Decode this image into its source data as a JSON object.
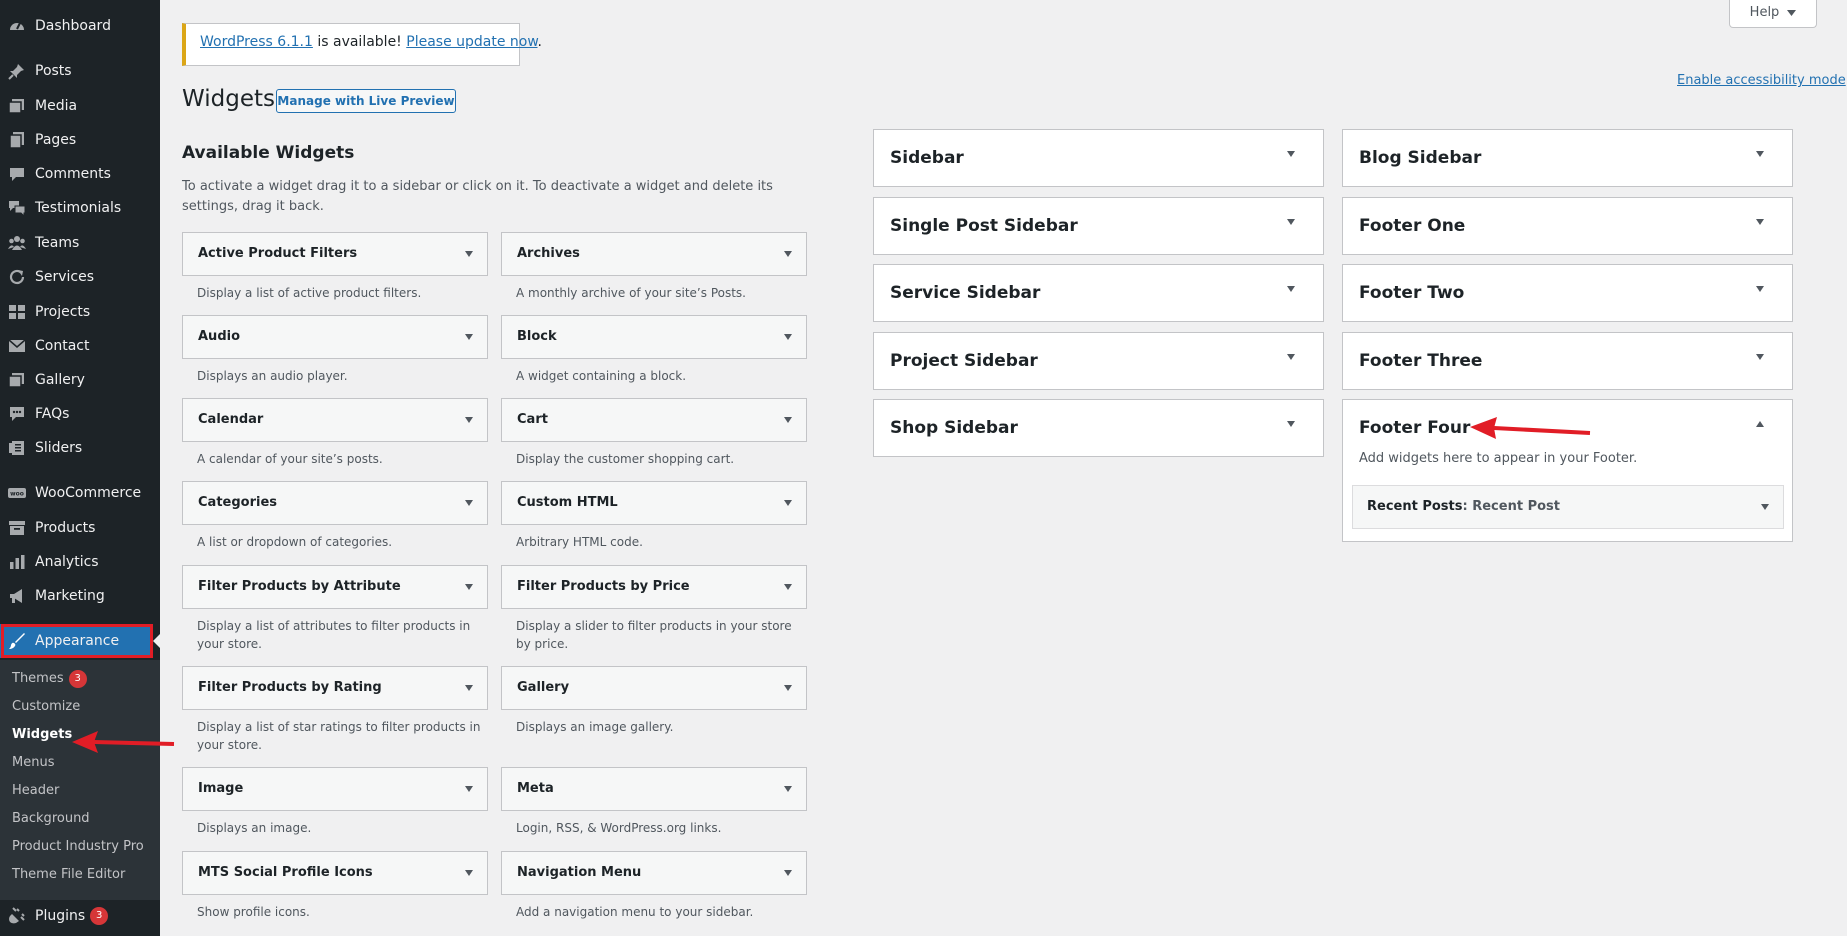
{
  "admin_menu": {
    "items": [
      {
        "label": "Dashboard",
        "icon": "dashboard-icon"
      },
      {
        "label": "Posts",
        "icon": "pin-icon"
      },
      {
        "label": "Media",
        "icon": "media-icon"
      },
      {
        "label": "Pages",
        "icon": "page-icon"
      },
      {
        "label": "Comments",
        "icon": "comment-icon"
      },
      {
        "label": "Testimonials",
        "icon": "testimonial-icon"
      },
      {
        "label": "Teams",
        "icon": "groups-icon"
      },
      {
        "label": "Services",
        "icon": "update-icon"
      },
      {
        "label": "Projects",
        "icon": "portfolio-icon"
      },
      {
        "label": "Contact",
        "icon": "email-icon"
      },
      {
        "label": "Gallery",
        "icon": "media-icon"
      },
      {
        "label": "FAQs",
        "icon": "comment-icon"
      },
      {
        "label": "Sliders",
        "icon": "slides-icon"
      },
      {
        "label": "WooCommerce",
        "icon": "woo-icon"
      },
      {
        "label": "Products",
        "icon": "archive-icon"
      },
      {
        "label": "Analytics",
        "icon": "chart-bar-icon"
      },
      {
        "label": "Marketing",
        "icon": "megaphone-icon"
      },
      {
        "label": "Appearance",
        "icon": "paintbrush-icon"
      },
      {
        "label": "Plugins",
        "icon": "plugin-icon"
      }
    ],
    "appearance_sub": [
      {
        "label": "Themes",
        "badge": "3"
      },
      {
        "label": "Customize"
      },
      {
        "label": "Widgets"
      },
      {
        "label": "Menus"
      },
      {
        "label": "Header"
      },
      {
        "label": "Background"
      },
      {
        "label": "Product Industry Pro"
      },
      {
        "label": "Theme File Editor"
      }
    ],
    "plugins_badge": "3"
  },
  "screen_meta": {
    "help_label": "Help"
  },
  "notice": {
    "version_link": "WordPress 6.1.1",
    "middle_text": " is available! ",
    "update_link": "Please update now",
    "end_text": "."
  },
  "page": {
    "title": "Widgets",
    "live_preview_label": "Manage with Live Preview",
    "accessibility_link": "Enable accessibility mode"
  },
  "available": {
    "title": "Available Widgets",
    "description": "To activate a widget drag it to a sidebar or click on it. To deactivate a widget and delete its settings, drag it back.",
    "widgets": [
      {
        "title": "Active Product Filters",
        "desc": "Display a list of active product filters."
      },
      {
        "title": "Archives",
        "desc": "A monthly archive of your site’s Posts."
      },
      {
        "title": "Audio",
        "desc": "Displays an audio player."
      },
      {
        "title": "Block",
        "desc": "A widget containing a block."
      },
      {
        "title": "Calendar",
        "desc": "A calendar of your site’s posts."
      },
      {
        "title": "Cart",
        "desc": "Display the customer shopping cart."
      },
      {
        "title": "Categories",
        "desc": "A list or dropdown of categories."
      },
      {
        "title": "Custom HTML",
        "desc": "Arbitrary HTML code."
      },
      {
        "title": "Filter Products by Attribute",
        "desc": "Display a list of attributes to filter products in your store."
      },
      {
        "title": "Filter Products by Price",
        "desc": "Display a slider to filter products in your store by price."
      },
      {
        "title": "Filter Products by Rating",
        "desc": "Display a list of star ratings to filter products in your store."
      },
      {
        "title": "Gallery",
        "desc": "Displays an image gallery."
      },
      {
        "title": "Image",
        "desc": "Displays an image."
      },
      {
        "title": "Meta",
        "desc": "Login, RSS, & WordPress.org links."
      },
      {
        "title": "MTS Social Profile Icons",
        "desc": "Show profile icons."
      },
      {
        "title": "Navigation Menu",
        "desc": "Add a navigation menu to your sidebar."
      }
    ]
  },
  "sidebars": {
    "left": [
      "Sidebar",
      "Single Post Sidebar",
      "Service Sidebar",
      "Project Sidebar",
      "Shop Sidebar"
    ],
    "right": [
      "Blog Sidebar",
      "Footer One",
      "Footer Two",
      "Footer Three",
      "Footer Four"
    ],
    "footer_four": {
      "description": "Add widgets here to appear in your Footer.",
      "widget_title": "Recent Posts",
      "widget_subtitle": ": Recent Post"
    }
  },
  "colors": {
    "menu_bg": "#1d2327",
    "accent": "#2271b1",
    "annotation_red": "#e11d26",
    "badge_red": "#d63638"
  }
}
